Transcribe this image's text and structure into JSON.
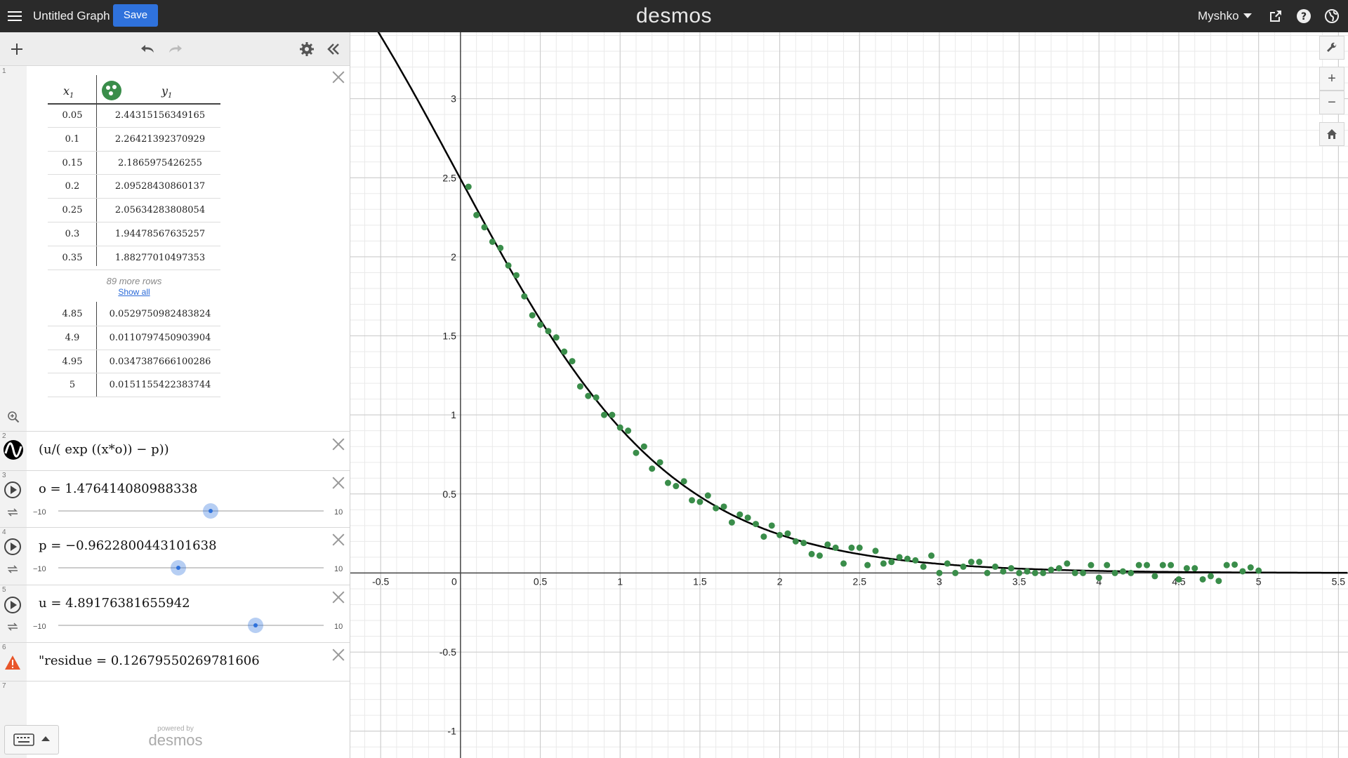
{
  "topbar": {
    "title": "Untitled Graph",
    "save_label": "Save",
    "brand": "desmos",
    "user": "Myshko"
  },
  "expressions": {
    "table": {
      "index": "1",
      "x_header": "x",
      "x_sub": "1",
      "y_header": "y",
      "y_sub": "1",
      "rows_top": [
        [
          "0.05",
          "2.44315156349165"
        ],
        [
          "0.1",
          "2.26421392370929"
        ],
        [
          "0.15",
          "2.1865975426255"
        ],
        [
          "0.2",
          "2.09528430860137"
        ],
        [
          "0.25",
          "2.05634283808054"
        ],
        [
          "0.3",
          "1.94478567635257"
        ],
        [
          "0.35",
          "1.88277010497353"
        ]
      ],
      "more_rows": "89 more rows",
      "show_all": "Show all",
      "rows_bottom": [
        [
          "4.85",
          "0.0529750982483824"
        ],
        [
          "4.9",
          "0.0110797450903904"
        ],
        [
          "4.95",
          "0.0347387666100286"
        ],
        [
          "5",
          "0.0151155422383744"
        ]
      ]
    },
    "fit": {
      "index": "2",
      "latex": "(u/( exp ((x*o)) − p))"
    },
    "o": {
      "index": "3",
      "label": "o = 1.476414080988338",
      "min": "−10",
      "max": "10",
      "value": 1.476414080988338
    },
    "p": {
      "index": "4",
      "label": "p = −0.9622800443101638",
      "min": "−10",
      "max": "10",
      "value": -0.9622800443101638
    },
    "u": {
      "index": "5",
      "label": "u = 4.89176381655942",
      "min": "−10",
      "max": "10",
      "value": 4.89176381655942
    },
    "residue": {
      "index": "6",
      "label": "\"residue = 0.12679550269781606"
    },
    "empty": {
      "index": "7"
    }
  },
  "footer": {
    "powered_small": "powered by",
    "powered_big": "desmos"
  },
  "icons": {
    "menu": "hamburger-icon",
    "share": "share-icon",
    "help": "help-icon",
    "language": "globe-icon",
    "add": "plus-icon",
    "undo": "undo-icon",
    "redo": "redo-icon",
    "settings": "gear-icon",
    "collapse": "double-chevron-left-icon",
    "zoom_fit": "zoom-fit-icon",
    "wrench": "wrench-icon",
    "zoom_in": "plus-icon",
    "zoom_out": "minus-icon",
    "home": "home-icon",
    "warning": "warning-icon",
    "keyboard": "keyboard-icon"
  },
  "colors": {
    "points": "#3a8d4a",
    "curve": "#000000",
    "save": "#2f72dc",
    "slider": "#2f72dc",
    "warning": "#e8562a"
  },
  "chart_data": {
    "type": "scatter",
    "x_ticks": [
      "-0.5",
      "0",
      "0.5",
      "1",
      "1.5",
      "2",
      "2.5",
      "3",
      "3.5",
      "4",
      "4.5",
      "5",
      "5.5"
    ],
    "y_ticks": [
      "-1",
      "-0.5",
      "0.5",
      "1",
      "1.5",
      "2",
      "2.5",
      "3"
    ],
    "xlim": [
      -0.69,
      5.56
    ],
    "ylim": [
      -1.17,
      3.42
    ],
    "grid": true,
    "curve": {
      "expression": "u/(exp(x*o) - p)",
      "u": 4.89176381655942,
      "o": 1.476414080988338,
      "p": -0.9622800443101638
    },
    "series": [
      {
        "name": "",
        "points": [
          [
            0.05,
            2.443
          ],
          [
            0.1,
            2.264
          ],
          [
            0.15,
            2.187
          ],
          [
            0.2,
            2.095
          ],
          [
            0.25,
            2.056
          ],
          [
            0.3,
            1.945
          ],
          [
            0.35,
            1.883
          ],
          [
            0.4,
            1.75
          ],
          [
            0.45,
            1.63
          ],
          [
            0.5,
            1.57
          ],
          [
            0.55,
            1.53
          ],
          [
            0.6,
            1.49
          ],
          [
            0.65,
            1.4
          ],
          [
            0.7,
            1.34
          ],
          [
            0.75,
            1.18
          ],
          [
            0.8,
            1.12
          ],
          [
            0.85,
            1.11
          ],
          [
            0.9,
            1.0
          ],
          [
            0.95,
            1.0
          ],
          [
            1.0,
            0.92
          ],
          [
            1.05,
            0.9
          ],
          [
            1.1,
            0.76
          ],
          [
            1.15,
            0.8
          ],
          [
            1.2,
            0.66
          ],
          [
            1.25,
            0.7
          ],
          [
            1.3,
            0.57
          ],
          [
            1.35,
            0.55
          ],
          [
            1.4,
            0.58
          ],
          [
            1.45,
            0.46
          ],
          [
            1.5,
            0.45
          ],
          [
            1.55,
            0.49
          ],
          [
            1.6,
            0.41
          ],
          [
            1.65,
            0.42
          ],
          [
            1.7,
            0.32
          ],
          [
            1.75,
            0.37
          ],
          [
            1.8,
            0.35
          ],
          [
            1.85,
            0.31
          ],
          [
            1.9,
            0.23
          ],
          [
            1.95,
            0.3
          ],
          [
            2.0,
            0.24
          ],
          [
            2.05,
            0.25
          ],
          [
            2.1,
            0.2
          ],
          [
            2.15,
            0.19
          ],
          [
            2.2,
            0.12
          ],
          [
            2.25,
            0.11
          ],
          [
            2.3,
            0.18
          ],
          [
            2.35,
            0.16
          ],
          [
            2.4,
            0.06
          ],
          [
            2.45,
            0.16
          ],
          [
            2.5,
            0.16
          ],
          [
            2.55,
            0.05
          ],
          [
            2.6,
            0.14
          ],
          [
            2.65,
            0.06
          ],
          [
            2.7,
            0.07
          ],
          [
            2.75,
            0.1
          ],
          [
            2.8,
            0.09
          ],
          [
            2.85,
            0.08
          ],
          [
            2.9,
            0.04
          ],
          [
            2.95,
            0.11
          ],
          [
            3.0,
            0.0
          ],
          [
            3.05,
            0.06
          ],
          [
            3.1,
            0.0
          ],
          [
            3.15,
            0.04
          ],
          [
            3.2,
            0.07
          ],
          [
            3.25,
            0.07
          ],
          [
            3.3,
            0.0
          ],
          [
            3.35,
            0.04
          ],
          [
            3.4,
            0.01
          ],
          [
            3.45,
            0.03
          ],
          [
            3.5,
            0.0
          ],
          [
            3.55,
            0.01
          ],
          [
            3.6,
            0.0
          ],
          [
            3.65,
            0.0
          ],
          [
            3.7,
            0.02
          ],
          [
            3.75,
            0.03
          ],
          [
            3.8,
            0.06
          ],
          [
            3.85,
            0.0
          ],
          [
            3.9,
            0.0
          ],
          [
            3.95,
            0.05
          ],
          [
            4.0,
            -0.03
          ],
          [
            4.05,
            0.05
          ],
          [
            4.1,
            0.0
          ],
          [
            4.15,
            0.01
          ],
          [
            4.2,
            0.0
          ],
          [
            4.25,
            0.05
          ],
          [
            4.3,
            0.05
          ],
          [
            4.35,
            -0.02
          ],
          [
            4.4,
            0.05
          ],
          [
            4.45,
            0.05
          ],
          [
            4.5,
            -0.04
          ],
          [
            4.55,
            0.03
          ],
          [
            4.6,
            0.03
          ],
          [
            4.65,
            -0.04
          ],
          [
            4.7,
            -0.02
          ],
          [
            4.75,
            -0.05
          ],
          [
            4.8,
            0.05
          ],
          [
            4.85,
            0.053
          ],
          [
            4.9,
            0.011
          ],
          [
            4.95,
            0.035
          ],
          [
            5.0,
            0.015
          ]
        ]
      }
    ]
  }
}
